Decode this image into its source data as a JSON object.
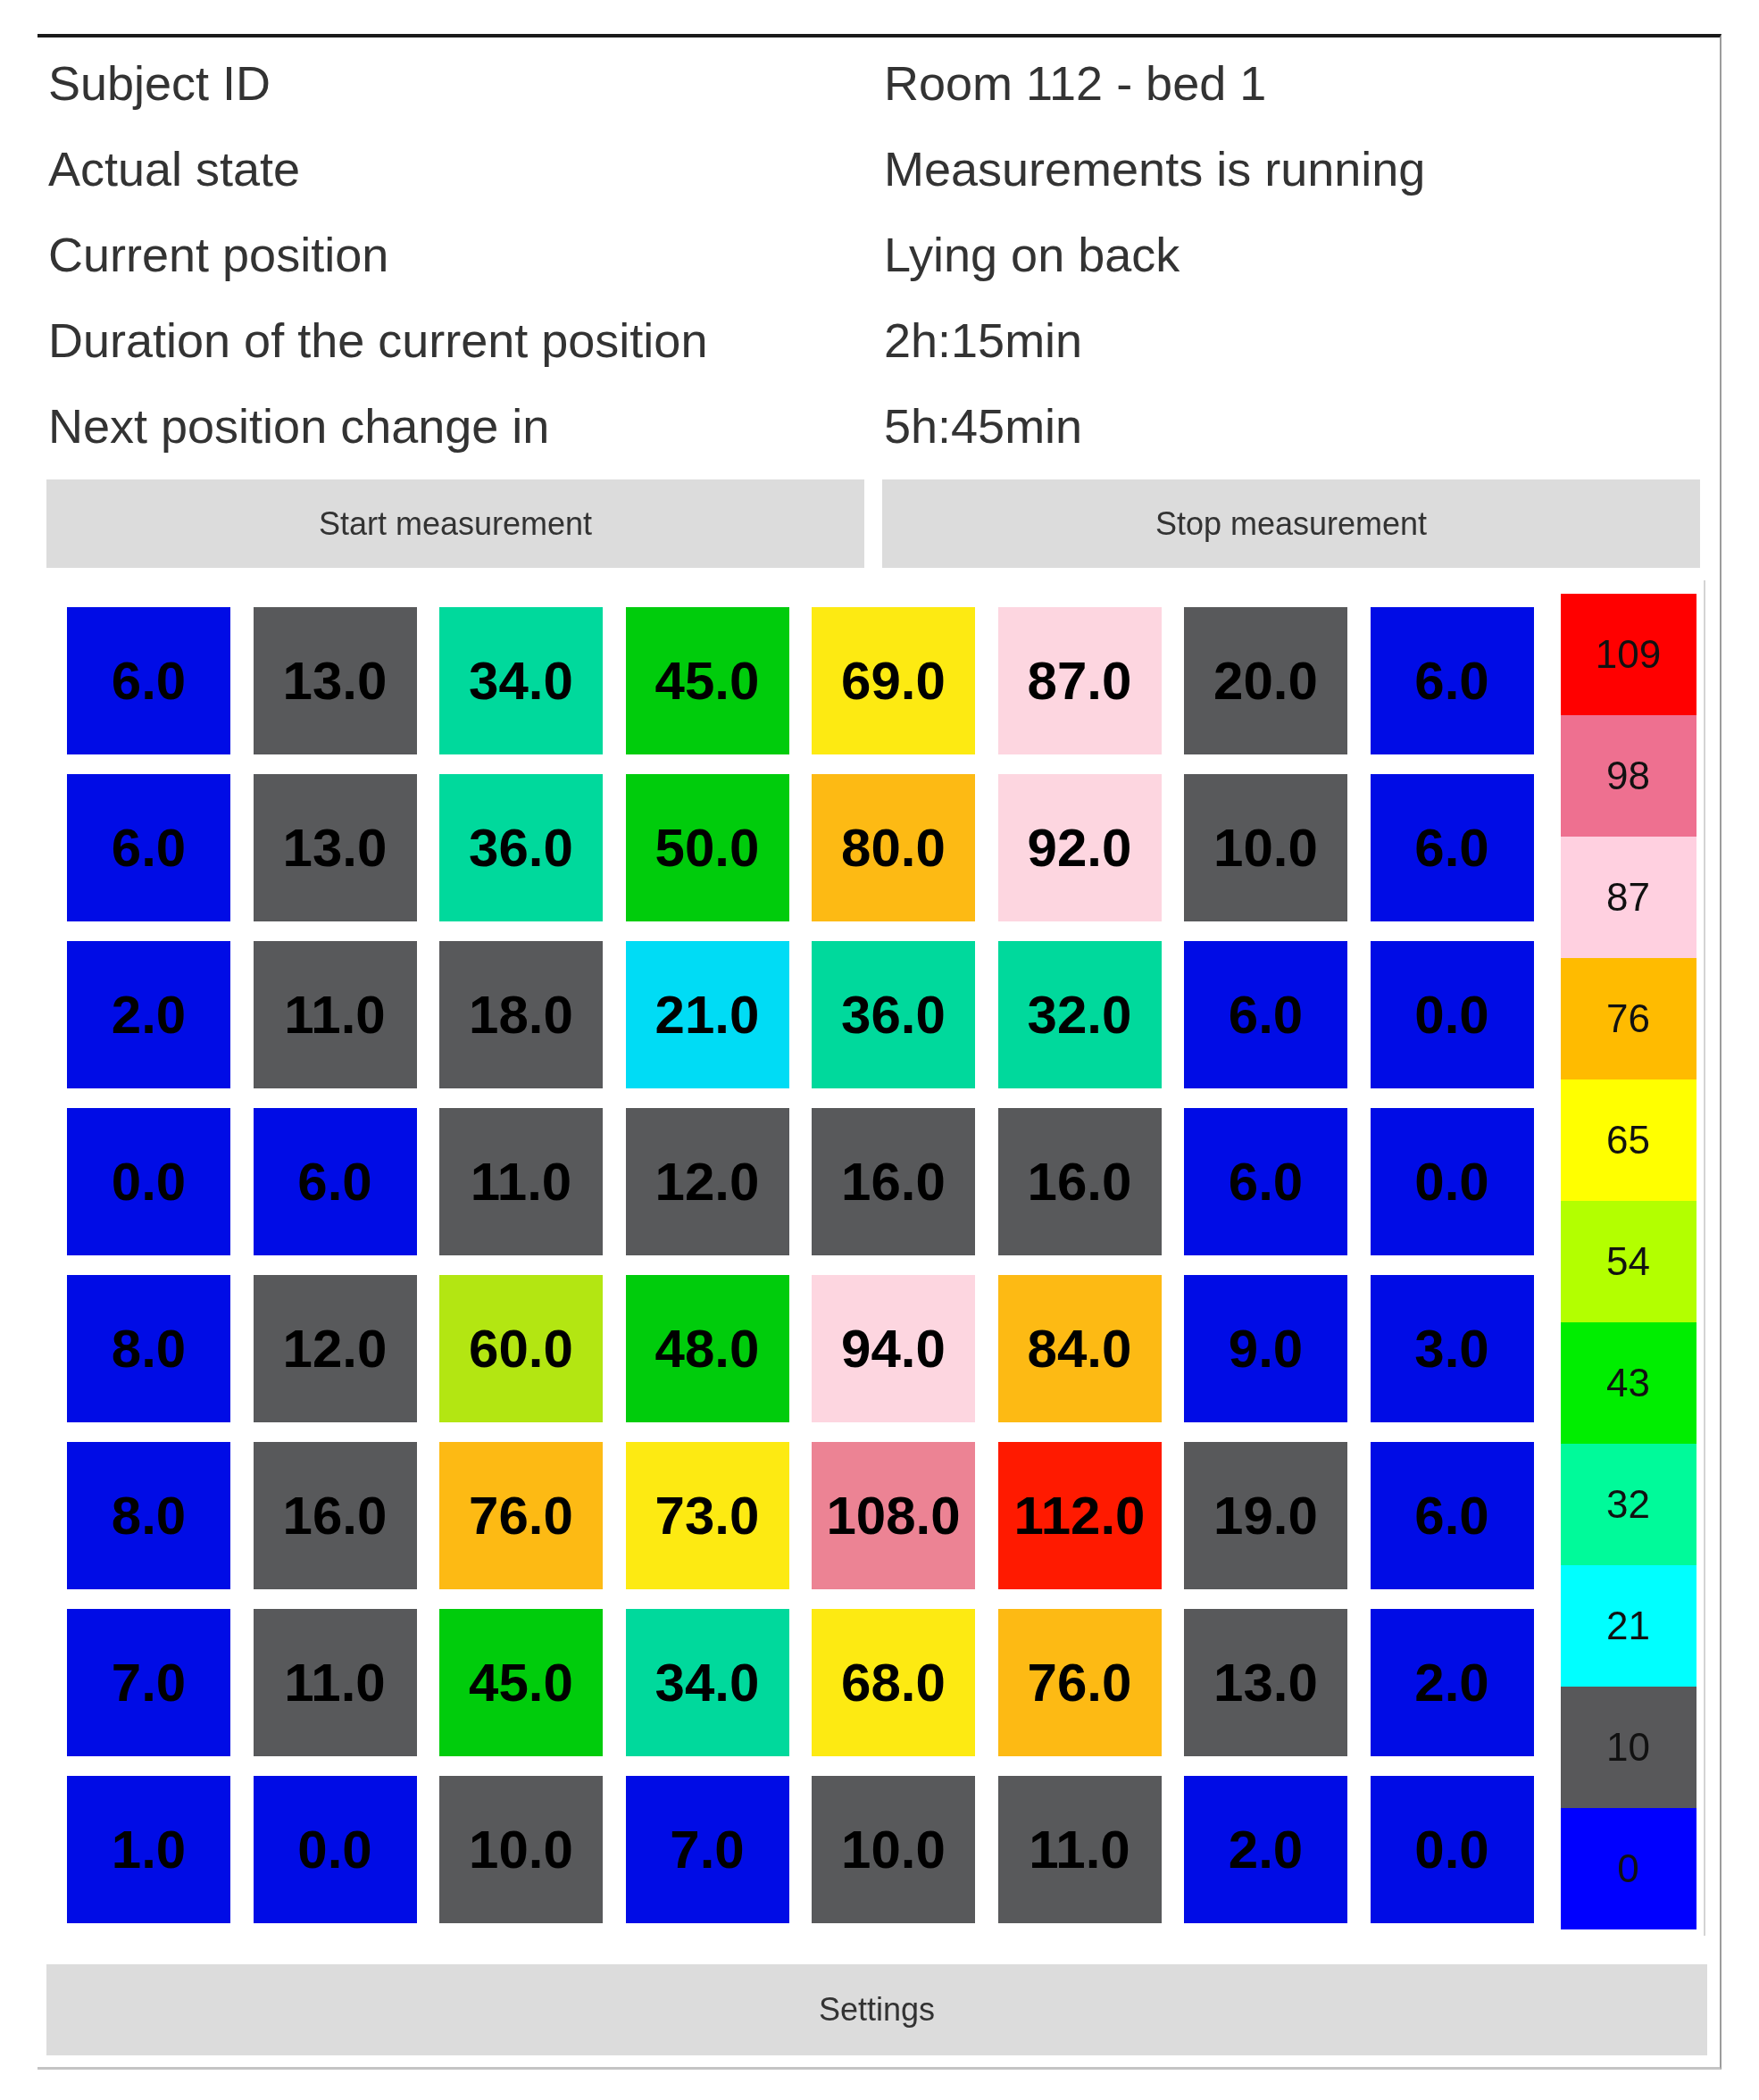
{
  "info": [
    {
      "label": "Subject ID",
      "value": "Room 112 - bed 1"
    },
    {
      "label": "Actual state",
      "value": "Measurements is running"
    },
    {
      "label": "Current position",
      "value": "Lying on back"
    },
    {
      "label": "Duration of the current position",
      "value": "2h:15min"
    },
    {
      "label": "Next position change in",
      "value": "5h:45min"
    }
  ],
  "measurement_buttons": [
    {
      "label": "Start measurement"
    },
    {
      "label": "Stop measurement"
    }
  ],
  "pressure_grid": {
    "rows": [
      {
        "cells": [
          {
            "value": "6.0",
            "color": "#000ce6"
          },
          {
            "value": "13.0",
            "color": "#58595b"
          },
          {
            "value": "34.0",
            "color": "#00d99c"
          },
          {
            "value": "45.0",
            "color": "#00cc0c"
          },
          {
            "value": "69.0",
            "color": "#fdea12"
          },
          {
            "value": "87.0",
            "color": "#fdd6e0"
          },
          {
            "value": "20.0",
            "color": "#58595b"
          },
          {
            "value": "6.0",
            "color": "#000ce6"
          }
        ]
      },
      {
        "cells": [
          {
            "value": "6.0",
            "color": "#000ce6"
          },
          {
            "value": "13.0",
            "color": "#58595b"
          },
          {
            "value": "36.0",
            "color": "#00d99c"
          },
          {
            "value": "50.0",
            "color": "#00cc0c"
          },
          {
            "value": "80.0",
            "color": "#fdba14"
          },
          {
            "value": "92.0",
            "color": "#fdd6e0"
          },
          {
            "value": "10.0",
            "color": "#58595b"
          },
          {
            "value": "6.0",
            "color": "#000ce6"
          }
        ]
      },
      {
        "cells": [
          {
            "value": "2.0",
            "color": "#000ce6"
          },
          {
            "value": "11.0",
            "color": "#58595b"
          },
          {
            "value": "18.0",
            "color": "#58595b"
          },
          {
            "value": "21.0",
            "color": "#00dcf5"
          },
          {
            "value": "36.0",
            "color": "#00d99c"
          },
          {
            "value": "32.0",
            "color": "#00d99c"
          },
          {
            "value": "6.0",
            "color": "#000ce6"
          },
          {
            "value": "0.0",
            "color": "#000ce6"
          }
        ]
      },
      {
        "cells": [
          {
            "value": "0.0",
            "color": "#000ce6"
          },
          {
            "value": "6.0",
            "color": "#000ce6"
          },
          {
            "value": "11.0",
            "color": "#58595b"
          },
          {
            "value": "12.0",
            "color": "#58595b"
          },
          {
            "value": "16.0",
            "color": "#58595b"
          },
          {
            "value": "16.0",
            "color": "#58595b"
          },
          {
            "value": "6.0",
            "color": "#000ce6"
          },
          {
            "value": "0.0",
            "color": "#000ce6"
          }
        ]
      },
      {
        "cells": [
          {
            "value": "8.0",
            "color": "#000ce6"
          },
          {
            "value": "12.0",
            "color": "#58595b"
          },
          {
            "value": "60.0",
            "color": "#b3e612"
          },
          {
            "value": "48.0",
            "color": "#00cc0c"
          },
          {
            "value": "94.0",
            "color": "#fdd6e0"
          },
          {
            "value": "84.0",
            "color": "#fdba14"
          },
          {
            "value": "9.0",
            "color": "#000ce6"
          },
          {
            "value": "3.0",
            "color": "#000ce6"
          }
        ]
      },
      {
        "cells": [
          {
            "value": "8.0",
            "color": "#000ce6"
          },
          {
            "value": "16.0",
            "color": "#58595b"
          },
          {
            "value": "76.0",
            "color": "#fdba14"
          },
          {
            "value": "73.0",
            "color": "#fdea12"
          },
          {
            "value": "108.0",
            "color": "#ec8394"
          },
          {
            "value": "112.0",
            "color": "#ff1a00"
          },
          {
            "value": "19.0",
            "color": "#58595b"
          },
          {
            "value": "6.0",
            "color": "#000ce6"
          }
        ]
      },
      {
        "cells": [
          {
            "value": "7.0",
            "color": "#000ce6"
          },
          {
            "value": "11.0",
            "color": "#58595b"
          },
          {
            "value": "45.0",
            "color": "#00cc0c"
          },
          {
            "value": "34.0",
            "color": "#00d99c"
          },
          {
            "value": "68.0",
            "color": "#fdea12"
          },
          {
            "value": "76.0",
            "color": "#fdba14"
          },
          {
            "value": "13.0",
            "color": "#58595b"
          },
          {
            "value": "2.0",
            "color": "#000ce6"
          }
        ]
      },
      {
        "cells": [
          {
            "value": "1.0",
            "color": "#000ce6"
          },
          {
            "value": "0.0",
            "color": "#000ce6"
          },
          {
            "value": "10.0",
            "color": "#58595b"
          },
          {
            "value": "7.0",
            "color": "#000ce6"
          },
          {
            "value": "10.0",
            "color": "#58595b"
          },
          {
            "value": "11.0",
            "color": "#58595b"
          },
          {
            "value": "2.0",
            "color": "#000ce6"
          },
          {
            "value": "0.0",
            "color": "#000ce6"
          }
        ]
      }
    ]
  },
  "legend": [
    {
      "label": "109",
      "color": "#ff0000"
    },
    {
      "label": "98",
      "color": "#ee7090"
    },
    {
      "label": "87",
      "color": "#ffd0e0"
    },
    {
      "label": "76",
      "color": "#ffbb00"
    },
    {
      "label": "65",
      "color": "#ffff00"
    },
    {
      "label": "54",
      "color": "#b3ff00"
    },
    {
      "label": "43",
      "color": "#00ee00"
    },
    {
      "label": "32",
      "color": "#00fa9a"
    },
    {
      "label": "21",
      "color": "#00ffff"
    },
    {
      "label": "10",
      "color": "#58585a"
    },
    {
      "label": "0",
      "color": "#0000ff"
    }
  ],
  "settings_button": {
    "label": "Settings"
  }
}
